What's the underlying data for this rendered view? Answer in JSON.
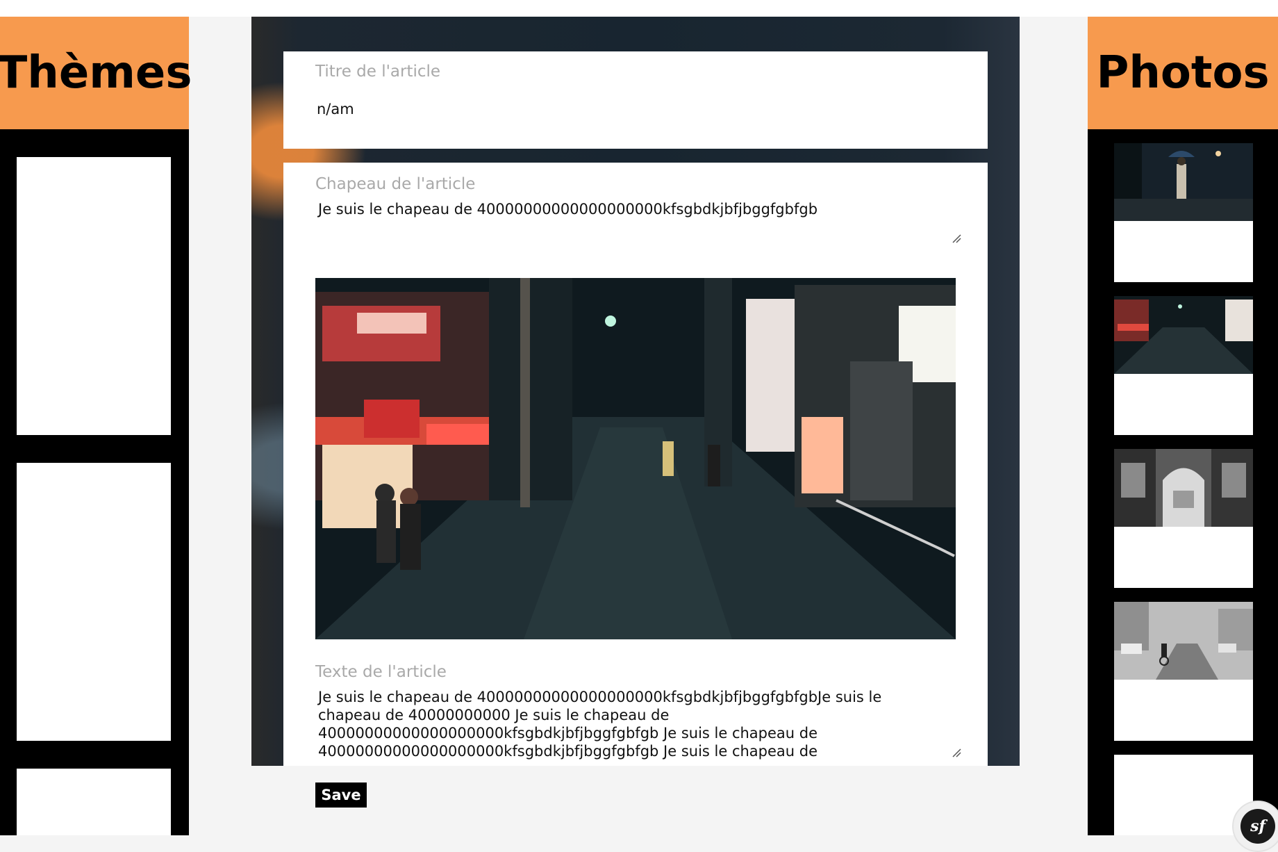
{
  "sidebar_left": {
    "title": "Thèmes"
  },
  "sidebar_right": {
    "title": "Photos",
    "thumbnails": [
      "photo-thumbnail-1",
      "photo-thumbnail-2",
      "photo-thumbnail-3",
      "photo-thumbnail-4"
    ]
  },
  "form": {
    "title_label": "Titre de l'article",
    "title_value": "n/am",
    "lead_label": "Chapeau de l'article",
    "lead_value": "Je suis le chapeau de 40000000000000000000kfsgbdkjbfjbggfgbfgb",
    "body_label": "Texte de l'article",
    "body_value": "Je suis le chapeau de 40000000000000000000kfsgbdkjbfjbggfgbfgbJe suis le chapeau de 40000000000 Je suis le chapeau de 40000000000000000000kfsgbdkjbfjbggfgbfgb Je suis le chapeau de 40000000000000000000kfsgbdkjbfjbggfgbfgb Je suis le chapeau de",
    "save_label": "Save"
  },
  "badge": {
    "label": "sf"
  },
  "colors": {
    "accent": "#f79a4e",
    "dark": "#000000",
    "panel": "#ffffff"
  }
}
